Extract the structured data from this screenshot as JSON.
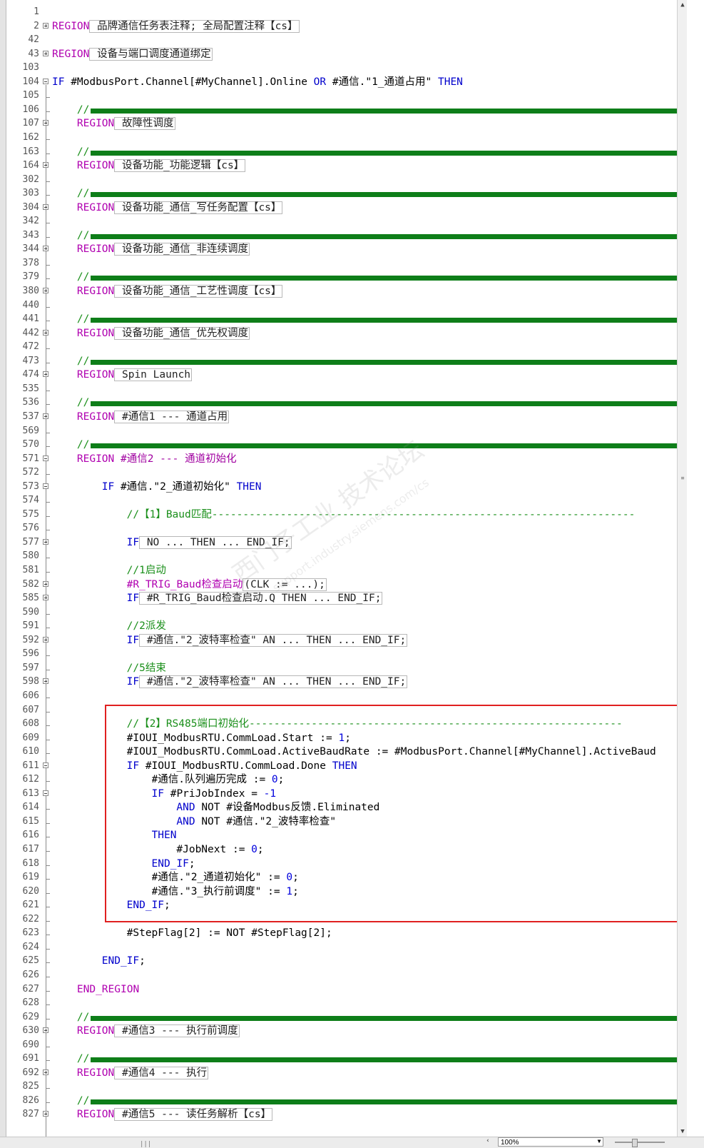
{
  "editor": {
    "lines": [
      {
        "n": "1",
        "f": "",
        "indent": 0,
        "t": []
      },
      {
        "n": "2",
        "f": "plus",
        "indent": 0,
        "t": [
          {
            "c": "reg",
            "v": "REGION"
          },
          {
            "c": "box",
            "v": " 品牌通信任务表注释; 全局配置注释【cs】"
          }
        ]
      },
      {
        "n": "42",
        "f": "",
        "indent": 0,
        "t": []
      },
      {
        "n": "43",
        "f": "plus",
        "indent": 0,
        "t": [
          {
            "c": "reg",
            "v": "REGION"
          },
          {
            "c": "box",
            "v": " 设备与端口调度通道绑定"
          }
        ]
      },
      {
        "n": "103",
        "f": "",
        "indent": 0,
        "t": []
      },
      {
        "n": "104",
        "f": "minus",
        "indent": 0,
        "t": [
          {
            "c": "kw",
            "v": "IF "
          },
          {
            "c": "var",
            "v": "#ModbusPort.Channel[#MyChannel].Online "
          },
          {
            "c": "kw",
            "v": "OR "
          },
          {
            "c": "var",
            "v": "#通信.\"1_通道占用\" "
          },
          {
            "c": "kw",
            "v": "THEN"
          }
        ]
      },
      {
        "n": "105",
        "f": "",
        "indent": 0,
        "t": []
      },
      {
        "n": "106",
        "f": "",
        "indent": 4,
        "divider": true,
        "t": [
          {
            "c": "cm",
            "v": "//"
          }
        ]
      },
      {
        "n": "107",
        "f": "plus",
        "indent": 4,
        "t": [
          {
            "c": "reg",
            "v": "REGION"
          },
          {
            "c": "box",
            "v": " 故障性调度"
          }
        ]
      },
      {
        "n": "162",
        "f": "",
        "indent": 0,
        "t": []
      },
      {
        "n": "163",
        "f": "",
        "indent": 4,
        "divider": true,
        "t": [
          {
            "c": "cm",
            "v": "//"
          }
        ]
      },
      {
        "n": "164",
        "f": "plus",
        "indent": 4,
        "t": [
          {
            "c": "reg",
            "v": "REGION"
          },
          {
            "c": "box",
            "v": " 设备功能_功能逻辑【cs】"
          }
        ]
      },
      {
        "n": "302",
        "f": "",
        "indent": 0,
        "t": []
      },
      {
        "n": "303",
        "f": "",
        "indent": 4,
        "divider": true,
        "t": [
          {
            "c": "cm",
            "v": "//"
          }
        ]
      },
      {
        "n": "304",
        "f": "plus",
        "indent": 4,
        "t": [
          {
            "c": "reg",
            "v": "REGION"
          },
          {
            "c": "box",
            "v": " 设备功能_通信_写任务配置【cs】"
          }
        ]
      },
      {
        "n": "342",
        "f": "",
        "indent": 0,
        "t": []
      },
      {
        "n": "343",
        "f": "",
        "indent": 4,
        "divider": true,
        "t": [
          {
            "c": "cm",
            "v": "//"
          }
        ]
      },
      {
        "n": "344",
        "f": "plus",
        "indent": 4,
        "t": [
          {
            "c": "reg",
            "v": "REGION"
          },
          {
            "c": "box",
            "v": " 设备功能_通信_非连续调度"
          }
        ]
      },
      {
        "n": "378",
        "f": "",
        "indent": 0,
        "t": []
      },
      {
        "n": "379",
        "f": "",
        "indent": 4,
        "divider": true,
        "t": [
          {
            "c": "cm",
            "v": "//"
          }
        ]
      },
      {
        "n": "380",
        "f": "plus",
        "indent": 4,
        "t": [
          {
            "c": "reg",
            "v": "REGION"
          },
          {
            "c": "box",
            "v": " 设备功能_通信_工艺性调度【cs】"
          }
        ]
      },
      {
        "n": "440",
        "f": "",
        "indent": 0,
        "t": []
      },
      {
        "n": "441",
        "f": "",
        "indent": 4,
        "divider": true,
        "t": [
          {
            "c": "cm",
            "v": "//"
          }
        ]
      },
      {
        "n": "442",
        "f": "plus",
        "indent": 4,
        "t": [
          {
            "c": "reg",
            "v": "REGION"
          },
          {
            "c": "box",
            "v": " 设备功能_通信_优先权调度"
          }
        ]
      },
      {
        "n": "472",
        "f": "",
        "indent": 0,
        "t": []
      },
      {
        "n": "473",
        "f": "",
        "indent": 4,
        "divider": true,
        "t": [
          {
            "c": "cm",
            "v": "//"
          }
        ]
      },
      {
        "n": "474",
        "f": "plus",
        "indent": 4,
        "t": [
          {
            "c": "reg",
            "v": "REGION"
          },
          {
            "c": "box",
            "v": " Spin Launch"
          }
        ]
      },
      {
        "n": "535",
        "f": "",
        "indent": 0,
        "t": []
      },
      {
        "n": "536",
        "f": "",
        "indent": 4,
        "divider": true,
        "t": [
          {
            "c": "cm",
            "v": "//"
          }
        ]
      },
      {
        "n": "537",
        "f": "plus",
        "indent": 4,
        "t": [
          {
            "c": "reg",
            "v": "REGION"
          },
          {
            "c": "box",
            "v": " #通信1 --- 通道占用"
          }
        ]
      },
      {
        "n": "569",
        "f": "",
        "indent": 0,
        "t": []
      },
      {
        "n": "570",
        "f": "",
        "indent": 4,
        "divider": true,
        "t": [
          {
            "c": "cm",
            "v": "//"
          }
        ]
      },
      {
        "n": "571",
        "f": "minus",
        "indent": 4,
        "t": [
          {
            "c": "reg",
            "v": "REGION "
          },
          {
            "c": "str",
            "v": "#通信2 --- 通道初始化"
          }
        ]
      },
      {
        "n": "572",
        "f": "",
        "indent": 0,
        "t": []
      },
      {
        "n": "573",
        "f": "minus",
        "indent": 8,
        "t": [
          {
            "c": "kw",
            "v": "IF "
          },
          {
            "c": "var",
            "v": "#通信.\"2_通道初始化\" "
          },
          {
            "c": "kw",
            "v": "THEN"
          }
        ]
      },
      {
        "n": "574",
        "f": "",
        "indent": 0,
        "t": []
      },
      {
        "n": "575",
        "f": "",
        "indent": 12,
        "t": [
          {
            "c": "cm",
            "v": "//【1】Baud匹配--------------------------------------------------------------------"
          }
        ]
      },
      {
        "n": "576",
        "f": "",
        "indent": 0,
        "t": []
      },
      {
        "n": "577",
        "f": "plus",
        "indent": 12,
        "t": [
          {
            "c": "kw",
            "v": "IF"
          },
          {
            "c": "box",
            "v": " NO ... THEN ... END_IF;"
          }
        ]
      },
      {
        "n": "580",
        "f": "",
        "indent": 0,
        "t": []
      },
      {
        "n": "581",
        "f": "",
        "indent": 12,
        "t": [
          {
            "c": "cm",
            "v": "//1启动"
          }
        ]
      },
      {
        "n": "582",
        "f": "plus",
        "indent": 12,
        "t": [
          {
            "c": "reg",
            "v": "#R_TRIG_Baud检查启动"
          },
          {
            "c": "box",
            "v": "(CLK := ...);"
          }
        ]
      },
      {
        "n": "585",
        "f": "plus",
        "indent": 12,
        "t": [
          {
            "c": "kw",
            "v": "IF"
          },
          {
            "c": "box",
            "v": " #R_TRIG_Baud检查启动.Q THEN ... END_IF;"
          }
        ]
      },
      {
        "n": "590",
        "f": "",
        "indent": 0,
        "t": []
      },
      {
        "n": "591",
        "f": "",
        "indent": 12,
        "t": [
          {
            "c": "cm",
            "v": "//2派发"
          }
        ]
      },
      {
        "n": "592",
        "f": "plus",
        "indent": 12,
        "t": [
          {
            "c": "kw",
            "v": "IF"
          },
          {
            "c": "box",
            "v": " #通信.\"2_波特率检查\" AN ... THEN ... END_IF;"
          }
        ]
      },
      {
        "n": "596",
        "f": "",
        "indent": 0,
        "t": []
      },
      {
        "n": "597",
        "f": "",
        "indent": 12,
        "t": [
          {
            "c": "cm",
            "v": "//5结束"
          }
        ]
      },
      {
        "n": "598",
        "f": "plus",
        "indent": 12,
        "t": [
          {
            "c": "kw",
            "v": "IF"
          },
          {
            "c": "box",
            "v": " #通信.\"2_波特率检查\" AN ... THEN ... END_IF;"
          }
        ]
      },
      {
        "n": "606",
        "f": "",
        "indent": 0,
        "t": []
      },
      {
        "n": "607",
        "f": "",
        "indent": 0,
        "t": []
      },
      {
        "n": "608",
        "f": "",
        "indent": 12,
        "t": [
          {
            "c": "cm",
            "v": "//【2】RS485端口初始化------------------------------------------------------------"
          }
        ]
      },
      {
        "n": "609",
        "f": "",
        "indent": 12,
        "t": [
          {
            "c": "var",
            "v": "#IOUI_ModbusRTU.CommLoad.Start "
          },
          {
            "c": "op",
            "v": ":= "
          },
          {
            "c": "num",
            "v": "1"
          },
          {
            "c": "op",
            "v": ";"
          }
        ]
      },
      {
        "n": "610",
        "f": "",
        "indent": 12,
        "t": [
          {
            "c": "var",
            "v": "#IOUI_ModbusRTU.CommLoad.ActiveBaudRate "
          },
          {
            "c": "op",
            "v": ":= "
          },
          {
            "c": "var",
            "v": "#ModbusPort.Channel[#MyChannel].ActiveBaud"
          }
        ]
      },
      {
        "n": "611",
        "f": "minus",
        "indent": 12,
        "t": [
          {
            "c": "kw",
            "v": "IF "
          },
          {
            "c": "var",
            "v": "#IOUI_ModbusRTU.CommLoad.Done "
          },
          {
            "c": "kw",
            "v": "THEN"
          }
        ]
      },
      {
        "n": "612",
        "f": "",
        "indent": 16,
        "t": [
          {
            "c": "var",
            "v": "#通信.队列遍历完成 "
          },
          {
            "c": "op",
            "v": ":= "
          },
          {
            "c": "num",
            "v": "0"
          },
          {
            "c": "op",
            "v": ";"
          }
        ]
      },
      {
        "n": "613",
        "f": "minus",
        "indent": 16,
        "t": [
          {
            "c": "kw",
            "v": "IF "
          },
          {
            "c": "var",
            "v": "#PriJobIndex = "
          },
          {
            "c": "num",
            "v": "-1"
          }
        ]
      },
      {
        "n": "614",
        "f": "",
        "indent": 20,
        "t": [
          {
            "c": "kw",
            "v": "AND "
          },
          {
            "c": "var",
            "v": "NOT #设备Modbus反馈.Eliminated"
          }
        ]
      },
      {
        "n": "615",
        "f": "",
        "indent": 20,
        "t": [
          {
            "c": "kw",
            "v": "AND "
          },
          {
            "c": "var",
            "v": "NOT #通信.\"2_波特率检查\""
          }
        ]
      },
      {
        "n": "616",
        "f": "",
        "indent": 16,
        "t": [
          {
            "c": "kw",
            "v": "THEN"
          }
        ]
      },
      {
        "n": "617",
        "f": "",
        "indent": 20,
        "t": [
          {
            "c": "var",
            "v": "#JobNext "
          },
          {
            "c": "op",
            "v": ":= "
          },
          {
            "c": "num",
            "v": "0"
          },
          {
            "c": "op",
            "v": ";"
          }
        ]
      },
      {
        "n": "618",
        "f": "",
        "indent": 16,
        "t": [
          {
            "c": "kw",
            "v": "END_IF"
          },
          {
            "c": "op",
            "v": ";"
          }
        ]
      },
      {
        "n": "619",
        "f": "",
        "indent": 16,
        "t": [
          {
            "c": "var",
            "v": "#通信.\"2_通道初始化\" "
          },
          {
            "c": "op",
            "v": ":= "
          },
          {
            "c": "num",
            "v": "0"
          },
          {
            "c": "op",
            "v": ";"
          }
        ]
      },
      {
        "n": "620",
        "f": "",
        "indent": 16,
        "t": [
          {
            "c": "var",
            "v": "#通信.\"3_执行前调度\" "
          },
          {
            "c": "op",
            "v": ":= "
          },
          {
            "c": "num",
            "v": "1"
          },
          {
            "c": "op",
            "v": ";"
          }
        ]
      },
      {
        "n": "621",
        "f": "",
        "indent": 12,
        "t": [
          {
            "c": "kw",
            "v": "END_IF"
          },
          {
            "c": "op",
            "v": ";"
          }
        ]
      },
      {
        "n": "622",
        "f": "",
        "indent": 0,
        "t": []
      },
      {
        "n": "623",
        "f": "",
        "indent": 12,
        "t": [
          {
            "c": "var",
            "v": "#StepFlag[2] := NOT #StepFlag[2];"
          }
        ]
      },
      {
        "n": "624",
        "f": "",
        "indent": 0,
        "t": []
      },
      {
        "n": "625",
        "f": "",
        "indent": 8,
        "t": [
          {
            "c": "kw",
            "v": "END_IF"
          },
          {
            "c": "op",
            "v": ";"
          }
        ]
      },
      {
        "n": "626",
        "f": "",
        "indent": 0,
        "t": []
      },
      {
        "n": "627",
        "f": "",
        "indent": 4,
        "t": [
          {
            "c": "reg",
            "v": "END_REGION"
          }
        ]
      },
      {
        "n": "628",
        "f": "",
        "indent": 0,
        "t": []
      },
      {
        "n": "629",
        "f": "",
        "indent": 4,
        "divider": true,
        "t": [
          {
            "c": "cm",
            "v": "//"
          }
        ]
      },
      {
        "n": "630",
        "f": "plus",
        "indent": 4,
        "t": [
          {
            "c": "reg",
            "v": "REGION"
          },
          {
            "c": "box",
            "v": " #通信3 --- 执行前调度"
          }
        ]
      },
      {
        "n": "690",
        "f": "",
        "indent": 0,
        "t": []
      },
      {
        "n": "691",
        "f": "",
        "indent": 4,
        "divider": true,
        "t": [
          {
            "c": "cm",
            "v": "//"
          }
        ]
      },
      {
        "n": "692",
        "f": "plus",
        "indent": 4,
        "t": [
          {
            "c": "reg",
            "v": "REGION"
          },
          {
            "c": "box",
            "v": " #通信4 --- 执行"
          }
        ]
      },
      {
        "n": "825",
        "f": "",
        "indent": 0,
        "t": []
      },
      {
        "n": "826",
        "f": "",
        "indent": 4,
        "divider": true,
        "t": [
          {
            "c": "cm",
            "v": "//"
          }
        ]
      },
      {
        "n": "827",
        "f": "plus",
        "indent": 4,
        "t": [
          {
            "c": "reg",
            "v": "REGION"
          },
          {
            "c": "box",
            "v": " #通信5 --- 读任务解析【cs】"
          }
        ]
      }
    ]
  },
  "watermark": {
    "line1": "西门子工业 技术论坛",
    "line2": "support.industry.siemens.com/cs"
  },
  "statusbar": {
    "zoom": "100%"
  },
  "icons": {
    "fold_expand": "plus-box-icon",
    "fold_collapse": "minus-box-icon",
    "scroll_up": "arrow-up-icon",
    "scroll_down": "arrow-down-icon"
  },
  "colors": {
    "keyword": "#0000cc",
    "region": "#b000b0",
    "comment": "#1a8f1a",
    "divider": "#0e7e19",
    "highlight": "#e02020"
  }
}
